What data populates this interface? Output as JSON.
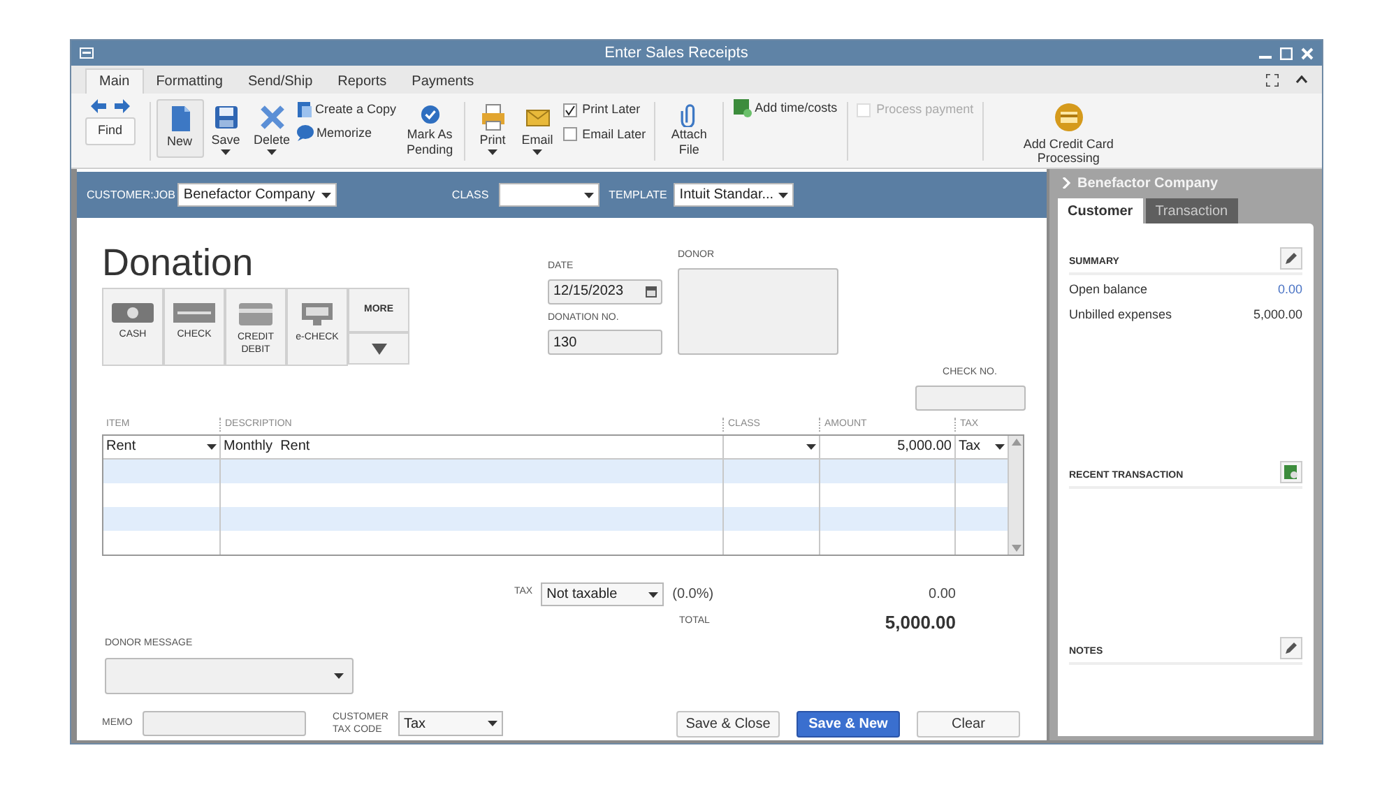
{
  "window": {
    "title": "Enter Sales Receipts"
  },
  "tabs": [
    {
      "label": "Main",
      "selected": true
    },
    {
      "label": "Formatting",
      "selected": false
    },
    {
      "label": "Send/Ship",
      "selected": false
    },
    {
      "label": "Reports",
      "selected": false
    },
    {
      "label": "Payments",
      "selected": false
    }
  ],
  "toolbar": [
    {
      "kind": "nav",
      "label": "Find"
    },
    {
      "kind": "separator"
    },
    {
      "kind": "big",
      "label": "New",
      "framed": true,
      "dropdown": false
    },
    {
      "kind": "big",
      "label": "Save",
      "framed": false,
      "dropdown": true
    },
    {
      "kind": "big",
      "label": "Delete",
      "framed": false,
      "dropdown": true
    },
    {
      "kind": "stack",
      "items": [
        {
          "label": "Create a Copy"
        },
        {
          "label": "Memorize"
        }
      ]
    },
    {
      "kind": "big",
      "label": "Mark As Pending",
      "framed": false,
      "dropdown": false
    },
    {
      "kind": "separator"
    },
    {
      "kind": "big",
      "label": "Print",
      "framed": false,
      "dropdown": true
    },
    {
      "kind": "big",
      "label": "Email",
      "framed": false,
      "dropdown": true
    },
    {
      "kind": "checks",
      "items": [
        {
          "label": "Print Later",
          "checked": true,
          "disabled": false
        },
        {
          "label": "Email Later",
          "checked": false,
          "disabled": false
        }
      ]
    },
    {
      "kind": "separator"
    },
    {
      "kind": "big",
      "label": "Attach File",
      "framed": false,
      "dropdown": false
    },
    {
      "kind": "separator"
    },
    {
      "kind": "small",
      "label": "Add time/costs"
    },
    {
      "kind": "separator"
    },
    {
      "kind": "checks",
      "items": [
        {
          "label": "Process payment",
          "checked": false,
          "disabled": true
        }
      ]
    },
    {
      "kind": "separator"
    },
    {
      "kind": "wide",
      "label": "Add Credit Card Processing"
    }
  ],
  "header": {
    "customer_job_label": "CUSTOMER:JOB",
    "customer_job": "Benefactor Company",
    "class_label": "CLASS",
    "template_label": "TEMPLATE",
    "template": "Intuit Standar..."
  },
  "form": {
    "title": "Donation",
    "payment_methods": [
      "CASH",
      "CHECK",
      "CREDIT DEBIT",
      "e-CHECK"
    ],
    "more": "MORE",
    "date_label": "DATE",
    "date": "12/15/2023",
    "number_label": "DONATION NO.",
    "number": "130",
    "donor_label": "DONOR",
    "check_no_label": "CHECK NO."
  },
  "table": {
    "columns": [
      "ITEM",
      "DESCRIPTION",
      "CLASS",
      "AMOUNT",
      "TAX"
    ],
    "rows": [
      {
        "item": "Rent",
        "description": "Monthly  Rent",
        "amount": "5,000.00",
        "tax": "Tax"
      }
    ]
  },
  "totals": {
    "tax_label": "TAX",
    "tax_code": "Not taxable",
    "tax_rate": "(0.0%)",
    "tax_amount": "0.00",
    "total_label": "TOTAL",
    "total": "5,000.00"
  },
  "footer": {
    "donor_message_label": "DONOR MESSAGE",
    "memo_label": "MEMO",
    "customer_tax_code_label": "CUSTOMER TAX CODE",
    "customer_tax_code": "Tax",
    "buttons": [
      {
        "label": "Save & Close",
        "kind": "default"
      },
      {
        "label": "Save & New",
        "kind": "primary"
      },
      {
        "label": "Clear",
        "kind": "default"
      }
    ]
  },
  "side_panel": {
    "title": "Benefactor Company",
    "tabs": [
      {
        "label": "Customer",
        "selected": true
      },
      {
        "label": "Transaction",
        "selected": false
      }
    ],
    "summary_title": "SUMMARY",
    "summary": [
      {
        "label": "Open balance",
        "value": "0.00",
        "link": true
      },
      {
        "label": "Unbilled expenses",
        "value": "5,000.00",
        "link": false
      }
    ],
    "recent_title": "RECENT TRANSACTION",
    "notes_title": "NOTES"
  }
}
